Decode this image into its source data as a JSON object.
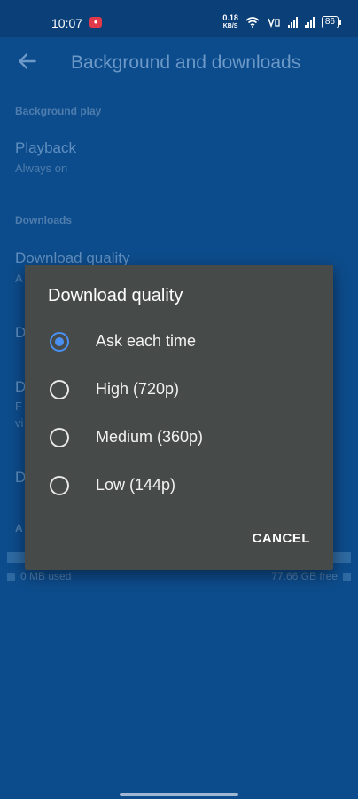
{
  "status": {
    "time": "10:07",
    "rec_label": "●",
    "net_speed_top": "0.18",
    "net_speed_unit": "KB/S",
    "battery": "86"
  },
  "header": {
    "title": "Background and downloads"
  },
  "sections": {
    "background_header": "Background play",
    "playback_title": "Playback",
    "playback_value": "Always on",
    "downloads_header": "Downloads",
    "download_quality_title": "Download quality",
    "download_quality_value_partial": "A",
    "row3_partial": "D",
    "row4_partial": "D",
    "row4_sub_partial_1": "F",
    "row4_sub_partial_2": "vi",
    "row5_partial": "D",
    "storage_header_partial": "A"
  },
  "storage": {
    "used": "0 MB used",
    "free": "77.66 GB free"
  },
  "dialog": {
    "title": "Download quality",
    "options": [
      {
        "label": "Ask each time",
        "checked": true
      },
      {
        "label": "High (720p)",
        "checked": false
      },
      {
        "label": "Medium (360p)",
        "checked": false
      },
      {
        "label": "Low (144p)",
        "checked": false
      }
    ],
    "cancel_label": "CANCEL"
  }
}
